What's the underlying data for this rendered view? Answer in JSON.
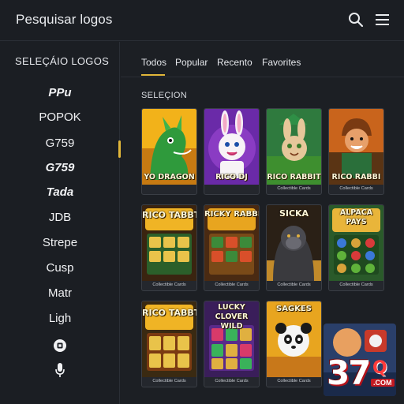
{
  "header": {
    "title": "Pesquisar logos",
    "search_icon": "search-icon",
    "menu_icon": "hamburger-menu-icon"
  },
  "sidebar": {
    "title": "SELEÇÁIO LOGOS",
    "items": [
      {
        "label": "PPu",
        "style": "logo"
      },
      {
        "label": "POPOK",
        "style": "text"
      },
      {
        "label": "G759",
        "style": "text"
      },
      {
        "label": "G759",
        "style": "logo"
      },
      {
        "label": "Tada",
        "style": "logo"
      },
      {
        "label": "JDB",
        "style": "text"
      },
      {
        "label": "Strepe",
        "style": "text"
      },
      {
        "label": "Cusp",
        "style": "text"
      },
      {
        "label": "Matr",
        "style": "text"
      },
      {
        "label": "Ligh",
        "style": "text"
      }
    ],
    "extra_icons": [
      "square-circle-icon",
      "microphone-icon"
    ]
  },
  "tabs": {
    "items": [
      "Todos",
      "Popular",
      "Recento",
      "Favorites"
    ],
    "active": "Todos"
  },
  "section_title": "SELEÇION",
  "games": [
    {
      "title": "YO DRAGON",
      "subtitle": ""
    },
    {
      "title": "RICO DJ",
      "subtitle": ""
    },
    {
      "title": "RICO RABBIT",
      "subtitle": "Collectible Cards"
    },
    {
      "title": "RICO RABBI",
      "subtitle": "Collectible Cards"
    },
    {
      "title": "RICO TABBT",
      "subtitle": "Collectible Cards"
    },
    {
      "title": "RICKY RABBIT",
      "subtitle": "Collectible Cards"
    },
    {
      "title": "SICKA",
      "subtitle": "Collectible Cards"
    },
    {
      "title": "ALPACA PAYS",
      "subtitle": "Collectible Cards"
    },
    {
      "title": "RICO TABBT",
      "subtitle": "Collectible Cards"
    },
    {
      "title": "LUCKY CLOVER WILD",
      "subtitle": "Collectible Cards"
    },
    {
      "title": "SAGKES",
      "subtitle": "Collectible Cards"
    }
  ],
  "badge": {
    "number": "37",
    "letter": "Q",
    "domain": ".COM"
  },
  "colors": {
    "accent": "#e2b73a",
    "background": "#1c1f24"
  }
}
